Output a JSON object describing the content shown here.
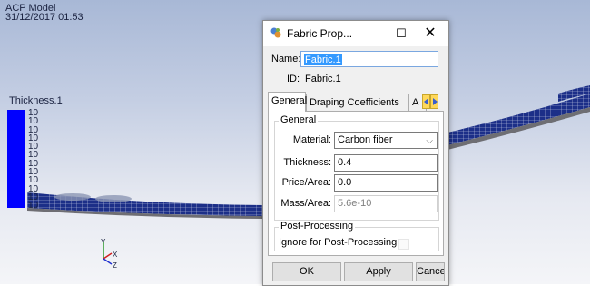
{
  "viewport": {
    "model_name": "ACP Model",
    "timestamp": "31/12/2017 01:53",
    "legend_title": "Thickness.1",
    "legend_values": [
      "10",
      "10",
      "10",
      "10",
      "10",
      "10",
      "10",
      "10",
      "10",
      "10",
      "10",
      "10"
    ],
    "legend_color": "#0000ff",
    "axis_labels": {
      "y": "Y",
      "x": "X",
      "z": "Z"
    }
  },
  "dialog": {
    "title": "Fabric Prop...",
    "name_label": "Name:",
    "name_value": "Fabric.1",
    "id_label": "ID:",
    "id_value": "Fabric.1",
    "tabs": [
      {
        "label": "General",
        "active": true
      },
      {
        "label": "Draping Coefficients",
        "active": false
      },
      {
        "label": "A",
        "active": false
      }
    ],
    "general": {
      "group_title": "General",
      "material_label": "Material:",
      "material_value": "Carbon fiber",
      "thickness_label": "Thickness:",
      "thickness_value": "0.4",
      "price_label": "Price/Area:",
      "price_value": "0.0",
      "mass_label": "Mass/Area:",
      "mass_value": "5.6e-10"
    },
    "post": {
      "group_title": "Post-Processing",
      "ignore_label": "Ignore for Post-Processing:"
    },
    "buttons": {
      "ok": "OK",
      "apply": "Apply",
      "cancel": "Cancel"
    },
    "window_controls": {
      "minimize": "—",
      "maximize": "☐",
      "close": "✕"
    }
  }
}
